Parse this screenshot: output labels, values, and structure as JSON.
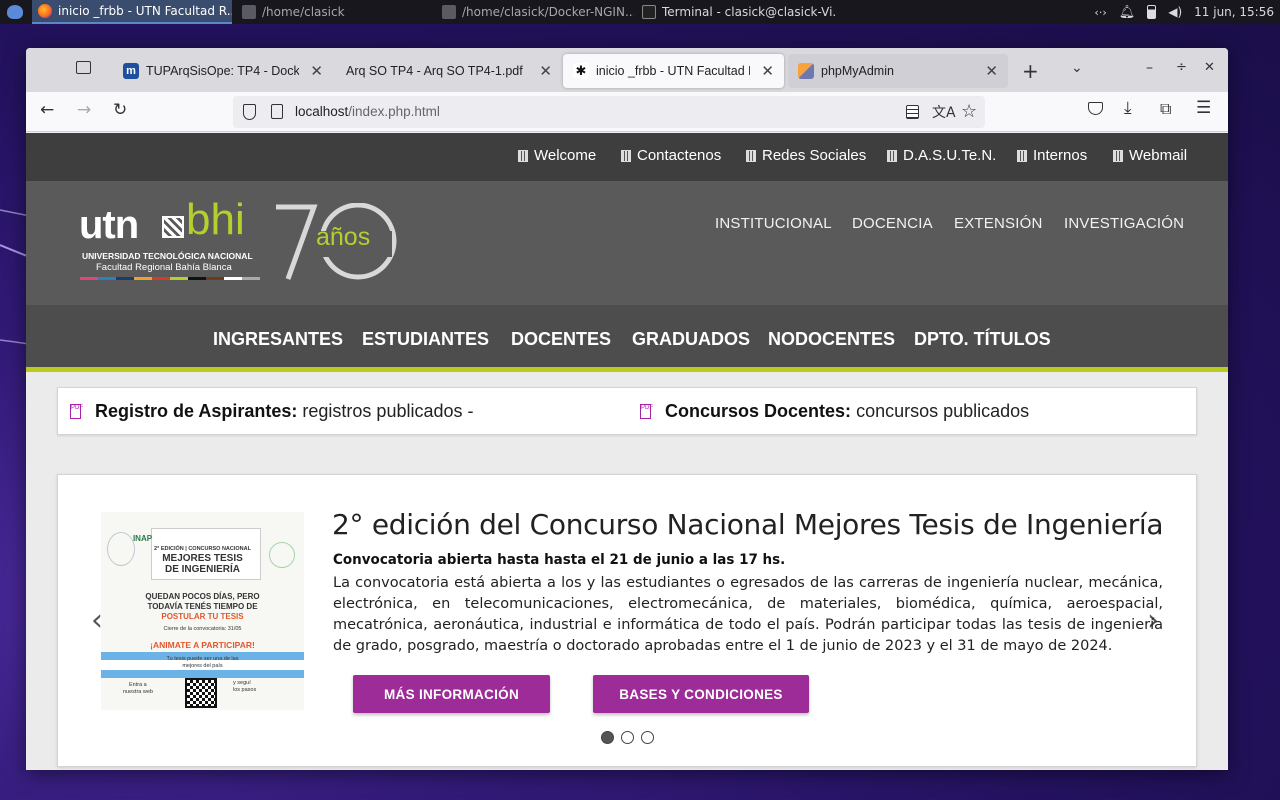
{
  "taskbar": {
    "items": [
      {
        "label": "inicio _frbb - UTN Facultad R..."
      },
      {
        "label": "/home/clasick"
      },
      {
        "label": "/home/clasick/Docker-NGIN..."
      },
      {
        "label": "Terminal - clasick@clasick-Vi..."
      }
    ],
    "clock": "11 jun, 15:56",
    "tray_icons": [
      "network-icon",
      "bell-icon",
      "battery-icon",
      "volume-icon"
    ]
  },
  "browser": {
    "tabs": [
      {
        "label": "TUPArqSisOpe: TP4 - Docker -"
      },
      {
        "label": "Arq SO TP4 - Arq SO TP4-1.pdf"
      },
      {
        "label": "inicio _frbb - UTN Facultad Re"
      },
      {
        "label": "phpMyAdmin"
      }
    ],
    "url_host": "localhost",
    "url_path": "/index.php.html"
  },
  "site": {
    "top_links": [
      "Welcome",
      "Contactenos",
      "Redes Sociales",
      "D.A.S.U.Te.N.",
      "Internos",
      "Webmail"
    ],
    "logo": {
      "utn": "utn",
      "bhi": "bhi",
      "line1": "UNIVERSIDAD TECNOLÓGICA NACIONAL",
      "line2": "Facultad Regional Bahía Blanca",
      "years": "70",
      "anos": "años"
    },
    "inst_links": [
      "INSTITUCIONAL",
      "DOCENCIA",
      "EXTENSIÓN",
      "INVESTIGACIÓN"
    ],
    "main_links": [
      "INGRESANTES",
      "ESTUDIANTES",
      "DOCENTES",
      "GRADUADOS",
      "NODOCENTES",
      "DPTO. TÍTULOS"
    ],
    "notices": [
      {
        "title": "Registro de Aspirantes:",
        "text": "registros publicados -"
      },
      {
        "title": "Concursos Docentes:",
        "text": "concursos publicados"
      }
    ],
    "slide": {
      "headline": "2° edición del Concurso Nacional Mejores Tesis de Ingeniería",
      "subtitle": "Convocatoria abierta hasta hasta el 21 de junio a las 17 hs.",
      "paragraph": "La convocatoria está abierta a los y las estudiantes o egresados de las carreras de ingeniería nuclear, mecánica, electrónica, en telecomunicaciones, electromecánica, de materiales, biomédica, química, aeroespacial, mecatrónica, aeronáutica, industrial e informática de todo el país. Podrán participar todas las tesis de ingeniería de grado, posgrado, maestría o doctorado aprobadas entre el 1 de junio de 2023 y el 31 de mayo de 2024.",
      "button1": "MÁS INFORMACIÓN",
      "button2": "BASES Y CONDICIONES",
      "active_dot": 0,
      "dots": 3,
      "poster": {
        "brand": "INAP",
        "line1": "2° EDICIÓN | CONCURSO NACIONAL",
        "line2": "MEJORES TESIS",
        "line3": "DE INGENIERÍA",
        "line4": "QUEDAN POCOS DÍAS, PERO",
        "line5": "TODAVÍA TENÉS TIEMPO DE",
        "line6": "POSTULAR TU TESIS",
        "line7": "Cierre de la convocatoria: 31/05",
        "line8": "¡ANIMATE A PARTICIPAR!",
        "line9": "Tu tesis puede ser una de las",
        "line10": "mejores del país",
        "line11": "Entra a",
        "line12": "nuestra web",
        "line13": "y seguí",
        "line14": "los pasos"
      }
    }
  },
  "colors": {
    "accent_green": "#b9cc1e",
    "button_purple": "#9d2c98"
  }
}
